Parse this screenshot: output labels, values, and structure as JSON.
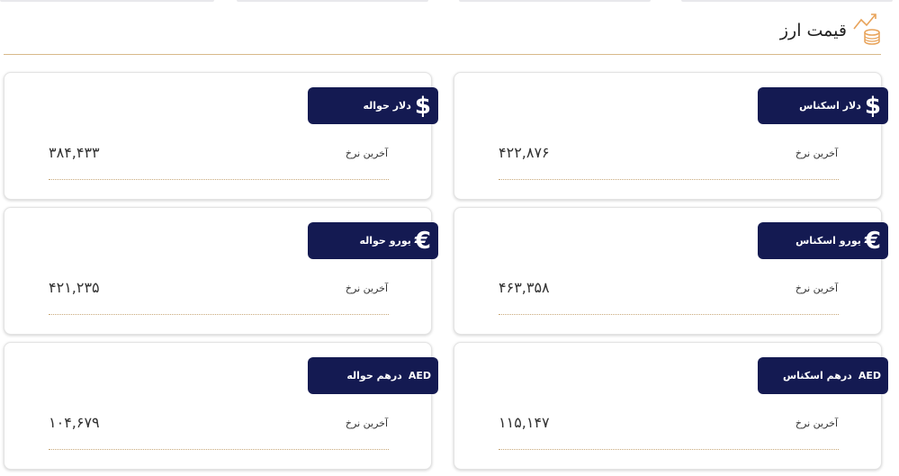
{
  "header": {
    "title": "قیمت ارز",
    "icon": "coins-chart-icon"
  },
  "cards": [
    {
      "name": "dollar-cash",
      "icon": "dollar-icon",
      "symbol": "$",
      "title": "دلار اسکناس",
      "label": "آخرین نرخ",
      "value": "۴۲۲,۸۷۶"
    },
    {
      "name": "dollar-transfer",
      "icon": "dollar-icon",
      "symbol": "$",
      "title": "دلار حواله",
      "label": "آخرین نرخ",
      "value": "۳۸۴,۴۳۳"
    },
    {
      "name": "euro-cash",
      "icon": "euro-icon",
      "symbol": "€",
      "title": "یورو اسکناس",
      "label": "آخرین نرخ",
      "value": "۴۶۳,۳۵۸"
    },
    {
      "name": "euro-transfer",
      "icon": "euro-icon",
      "symbol": "€",
      "title": "یورو حواله",
      "label": "آخرین نرخ",
      "value": "۴۲۱,۲۳۵"
    },
    {
      "name": "aed-cash",
      "code": "AED",
      "title": "درهم اسکناس",
      "label": "آخرین نرخ",
      "value": "۱۱۵,۱۴۷"
    },
    {
      "name": "aed-transfer",
      "code": "AED",
      "title": "درهم حواله",
      "label": "آخرین نرخ",
      "value": "۱۰۴,۶۷۹"
    }
  ],
  "colors": {
    "badge": "#141a52",
    "accent_line": "#d8b98a",
    "icon_accent": "#e8a35a"
  }
}
